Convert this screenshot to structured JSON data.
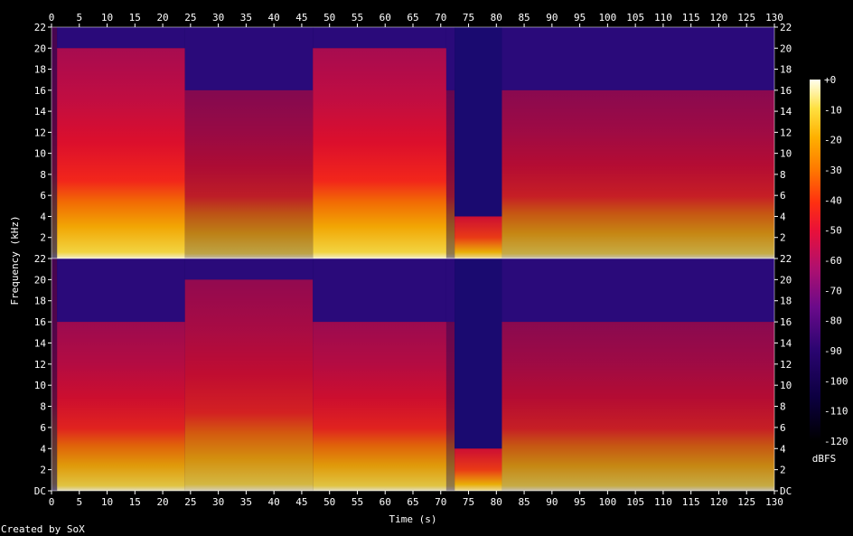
{
  "chart_data": {
    "type": "heatmap",
    "title": "",
    "xlabel": "Time (s)",
    "ylabel": "Frequency (kHz)",
    "colorbar_label": "dBFS",
    "credit": "Created by SoX",
    "xlim": [
      0,
      130
    ],
    "x_ticks": [
      0,
      5,
      10,
      15,
      20,
      25,
      30,
      35,
      40,
      45,
      50,
      55,
      60,
      65,
      70,
      75,
      80,
      85,
      90,
      95,
      100,
      105,
      110,
      115,
      120,
      125,
      130
    ],
    "ylim": [
      0,
      22
    ],
    "y_ticks": [
      {
        "value": 0,
        "label": "DC"
      },
      {
        "value": 2,
        "label": "2"
      },
      {
        "value": 4,
        "label": "4"
      },
      {
        "value": 6,
        "label": "6"
      },
      {
        "value": 8,
        "label": "8"
      },
      {
        "value": 10,
        "label": "10"
      },
      {
        "value": 12,
        "label": "12"
      },
      {
        "value": 14,
        "label": "14"
      },
      {
        "value": 16,
        "label": "16"
      },
      {
        "value": 18,
        "label": "18"
      },
      {
        "value": 20,
        "label": "20"
      },
      {
        "value": 22,
        "label": "22"
      }
    ],
    "colorbar_range": [
      -120,
      0
    ],
    "colorbar_ticks": [
      "+0",
      "-10",
      "-20",
      "-30",
      "-40",
      "-50",
      "-60",
      "-70",
      "-80",
      "-90",
      "-100",
      "-110",
      "-120"
    ],
    "channels": [
      {
        "segments": [
          {
            "start": 0,
            "end": 1,
            "cutoff": 22,
            "level": -90
          },
          {
            "start": 1,
            "end": 24,
            "cutoff": 20,
            "level": -48
          },
          {
            "start": 24,
            "end": 47,
            "cutoff": 16,
            "level": -60
          },
          {
            "start": 47,
            "end": 71,
            "cutoff": 20,
            "level": -48
          },
          {
            "start": 71,
            "end": 72.5,
            "cutoff": 16,
            "level": -70
          },
          {
            "start": 72.5,
            "end": 81,
            "cutoff": 4,
            "level": -50
          },
          {
            "start": 81,
            "end": 130,
            "cutoff": 16,
            "level": -58
          }
        ]
      },
      {
        "segments": [
          {
            "start": 0,
            "end": 1,
            "cutoff": 22,
            "level": -90
          },
          {
            "start": 1,
            "end": 24,
            "cutoff": 16,
            "level": -52
          },
          {
            "start": 24,
            "end": 47,
            "cutoff": 20,
            "level": -55
          },
          {
            "start": 47,
            "end": 71,
            "cutoff": 16,
            "level": -52
          },
          {
            "start": 71,
            "end": 72.5,
            "cutoff": 16,
            "level": -70
          },
          {
            "start": 72.5,
            "end": 81,
            "cutoff": 4,
            "level": -50
          },
          {
            "start": 81,
            "end": 130,
            "cutoff": 16,
            "level": -58
          }
        ]
      }
    ]
  }
}
